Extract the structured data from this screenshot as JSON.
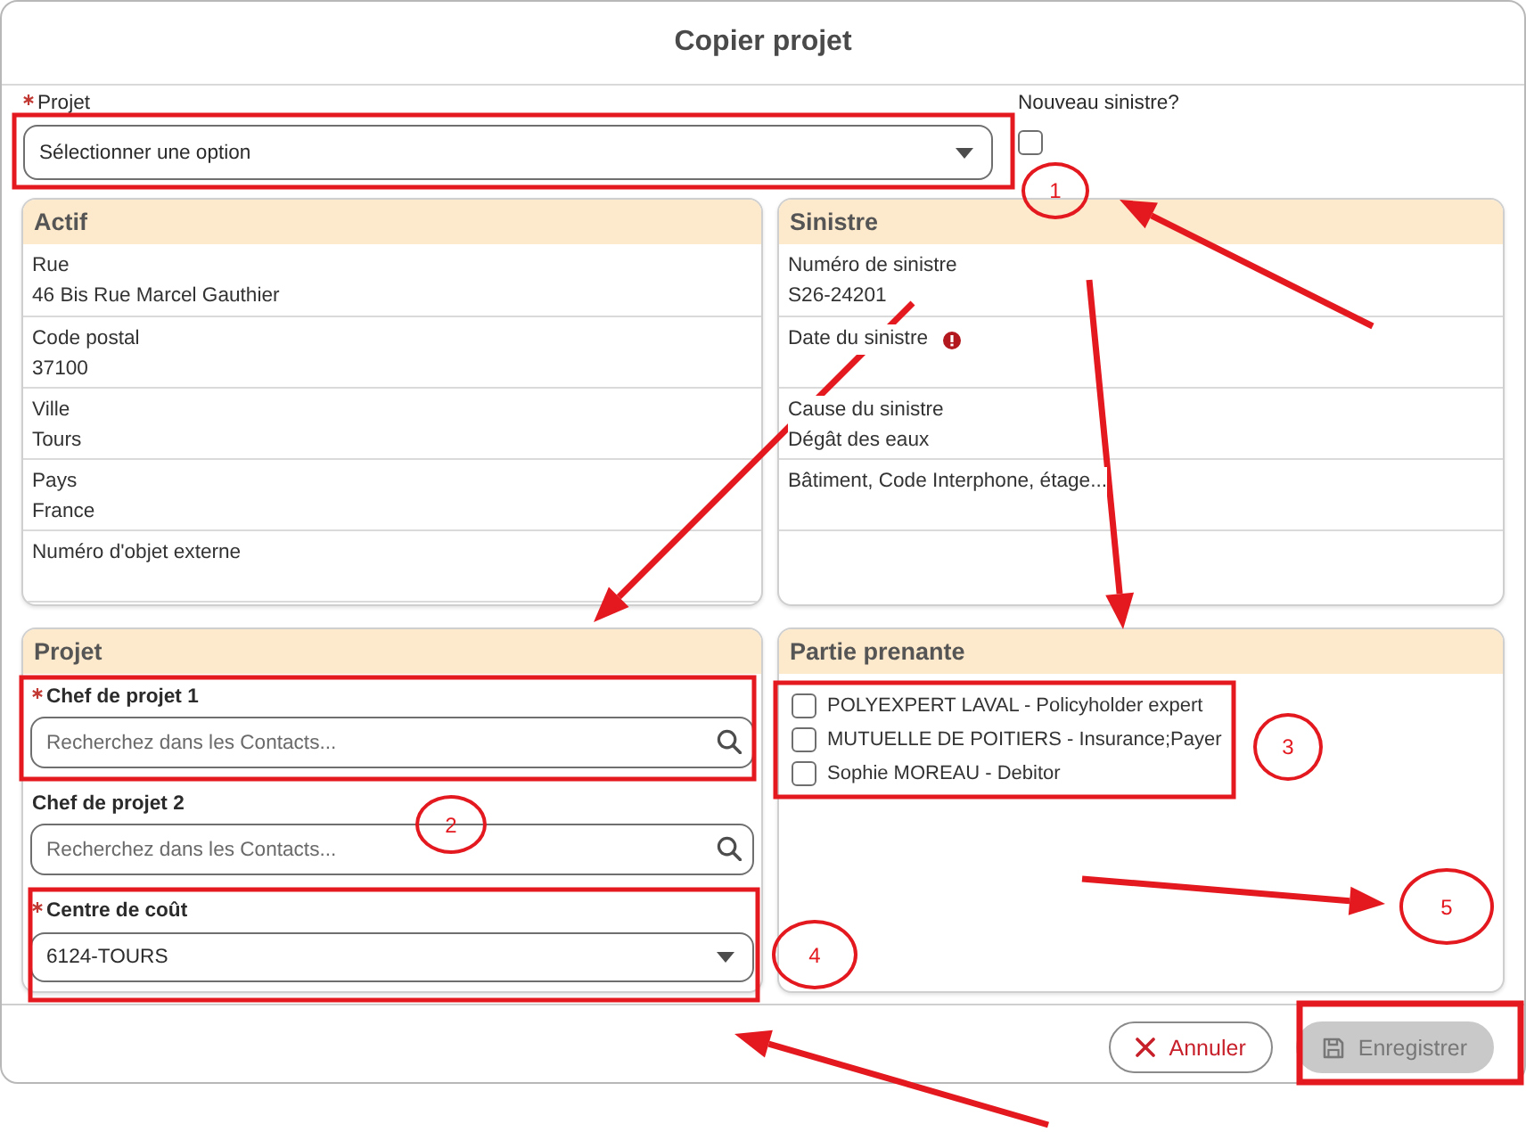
{
  "dialog": {
    "title": "Copier projet"
  },
  "project_field": {
    "label": "Projet",
    "required": true,
    "placeholder": "Sélectionner une option"
  },
  "new_claim": {
    "label": "Nouveau sinistre?",
    "checked": false
  },
  "info_panels": [
    {
      "title": "Actif",
      "rows": [
        {
          "label": "Rue",
          "value": "46 Bis Rue Marcel Gauthier",
          "alert": false
        },
        {
          "label": "Code postal",
          "value": "37100",
          "alert": false
        },
        {
          "label": "Ville",
          "value": "Tours",
          "alert": false
        },
        {
          "label": "Pays",
          "value": "France",
          "alert": false
        },
        {
          "label": "Numéro d'objet externe",
          "alert": false
        }
      ]
    },
    {
      "title": "Sinistre",
      "rows": [
        {
          "label": "Numéro de sinistre",
          "value": "S26-24201",
          "alert": false
        },
        {
          "label": "Date du sinistre",
          "alert": true
        },
        {
          "label": "Cause du sinistre",
          "value": "Dégât des eaux",
          "alert": false
        },
        {
          "label": "Bâtiment, Code Interphone, étage...",
          "alert": false
        }
      ]
    }
  ],
  "project_panel": {
    "title": "Projet",
    "fields": [
      {
        "kind": "search",
        "label": "Chef de projet 1",
        "required": true,
        "placeholder": "Recherchez dans les Contacts..."
      },
      {
        "kind": "search",
        "label": "Chef de projet 2",
        "required": false,
        "placeholder": "Recherchez dans les Contacts..."
      },
      {
        "kind": "select",
        "label": "Centre de coût",
        "required": true,
        "value": "6124-TOURS"
      }
    ]
  },
  "stakeholders": {
    "title": "Partie prenante",
    "items": [
      {
        "label": "POLYEXPERT LAVAL - Policyholder expert",
        "checked": false
      },
      {
        "label": "MUTUELLE DE POITIERS - Insurance;Payer",
        "checked": false
      },
      {
        "label": "Sophie MOREAU - Debitor",
        "checked": false
      }
    ]
  },
  "footer": {
    "buttons": [
      {
        "kind": "cancel",
        "label": "Annuler",
        "disabled": false
      },
      {
        "kind": "save",
        "label": "Enregistrer",
        "disabled": true
      }
    ]
  },
  "annotations": [
    {
      "label": "1"
    },
    {
      "label": "2"
    },
    {
      "label": "3"
    },
    {
      "label": "4"
    },
    {
      "label": "5"
    }
  ]
}
